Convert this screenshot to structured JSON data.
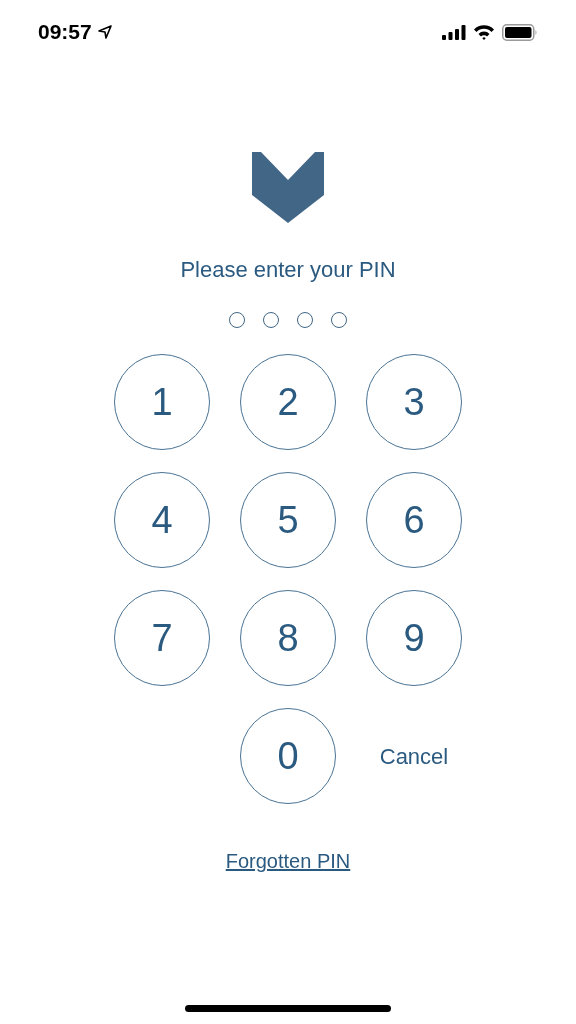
{
  "status_bar": {
    "time": "09:57"
  },
  "prompt": "Please enter your PIN",
  "pin_dots": [
    {
      "filled": false
    },
    {
      "filled": false
    },
    {
      "filled": false
    },
    {
      "filled": false
    }
  ],
  "keypad": [
    {
      "kind": "digit",
      "label": "1"
    },
    {
      "kind": "digit",
      "label": "2"
    },
    {
      "kind": "digit",
      "label": "3"
    },
    {
      "kind": "digit",
      "label": "4"
    },
    {
      "kind": "digit",
      "label": "5"
    },
    {
      "kind": "digit",
      "label": "6"
    },
    {
      "kind": "digit",
      "label": "7"
    },
    {
      "kind": "digit",
      "label": "8"
    },
    {
      "kind": "digit",
      "label": "9"
    },
    {
      "kind": "blank"
    },
    {
      "kind": "digit",
      "label": "0"
    },
    {
      "kind": "text",
      "label": "Cancel"
    }
  ],
  "forgot_link": "Forgotten PIN"
}
